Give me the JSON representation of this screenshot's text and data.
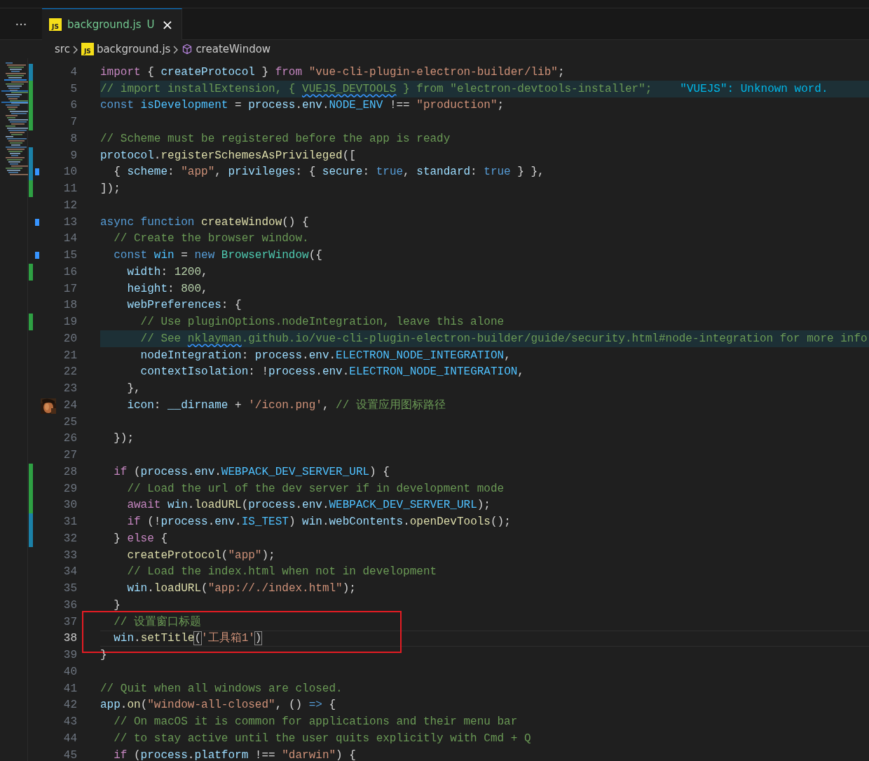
{
  "tab_bar": {
    "more": "···",
    "tabs": [
      {
        "icon_text": "JS",
        "label": "background.js",
        "status": "U",
        "close": "×",
        "selected": true
      }
    ]
  },
  "breadcrumb": [
    {
      "label": "src"
    },
    {
      "label": "background.js",
      "icon_text": "JS",
      "kind": "file"
    },
    {
      "label": "createWindow",
      "kind": "symbol"
    }
  ],
  "lines": [
    {
      "number": "4",
      "change_marker": {
        "color": "#1b81a8"
      },
      "tokens": [
        {
          "kind": "control",
          "text": "import"
        },
        {
          "kind": "plain",
          "text": " { "
        },
        {
          "kind": "variable",
          "text": "createProtocol"
        },
        {
          "kind": "plain",
          "text": " } "
        },
        {
          "kind": "control",
          "text": "from"
        },
        {
          "kind": "string",
          "text": " \"vue-cli-plugin-electron-builder/lib\""
        },
        {
          "kind": "plain",
          "text": ";"
        }
      ]
    },
    {
      "number": "5",
      "change_marker": {
        "color": "#2ea043"
      },
      "highlighted": true,
      "diagnostic": "\"VUEJS\": Unknown word.",
      "tokens": [
        {
          "kind": "comment",
          "text": "// import installExtension, { "
        },
        {
          "kind": "comment",
          "text": "VUEJS_DEVTOOLS",
          "squiggle": true
        },
        {
          "kind": "comment",
          "text": " } from \"electron-devtools-installer\";"
        }
      ]
    },
    {
      "number": "6",
      "change_marker": {
        "color": "#2ea043"
      },
      "tokens": [
        {
          "kind": "keyword",
          "text": "const"
        },
        {
          "kind": "constant",
          "text": " isDevelopment"
        },
        {
          "kind": "plain",
          "text": " = "
        },
        {
          "kind": "variable",
          "text": "process"
        },
        {
          "kind": "plain",
          "text": "."
        },
        {
          "kind": "variable",
          "text": "env"
        },
        {
          "kind": "plain",
          "text": "."
        },
        {
          "kind": "constant",
          "text": "NODE_ENV"
        },
        {
          "kind": "plain",
          "text": " !== "
        },
        {
          "kind": "string",
          "text": "\"production\""
        },
        {
          "kind": "plain",
          "text": ";"
        }
      ]
    },
    {
      "number": "7",
      "change_marker": {
        "color": "#2ea043"
      }
    },
    {
      "number": "8",
      "tokens": [
        {
          "kind": "comment",
          "text": "// Scheme must be registered before the app is ready"
        }
      ]
    },
    {
      "number": "9",
      "change_marker": {
        "color": "#1b81a8"
      },
      "tokens": [
        {
          "kind": "variable",
          "text": "protocol"
        },
        {
          "kind": "plain",
          "text": "."
        },
        {
          "kind": "function",
          "text": "registerSchemesAsPrivileged"
        },
        {
          "kind": "plain",
          "text": "(["
        }
      ]
    },
    {
      "number": "10",
      "change_marker": {
        "color": "#1b81a8"
      },
      "marker": true,
      "tokens": [
        {
          "kind": "plain",
          "text": "  { "
        },
        {
          "kind": "variable",
          "text": "scheme"
        },
        {
          "kind": "plain",
          "text": ": "
        },
        {
          "kind": "string",
          "text": "\"app\""
        },
        {
          "kind": "plain",
          "text": ", "
        },
        {
          "kind": "variable",
          "text": "privileges"
        },
        {
          "kind": "plain",
          "text": ": { "
        },
        {
          "kind": "variable",
          "text": "secure"
        },
        {
          "kind": "plain",
          "text": ": "
        },
        {
          "kind": "keyword",
          "text": "true"
        },
        {
          "kind": "plain",
          "text": ", "
        },
        {
          "kind": "variable",
          "text": "standard"
        },
        {
          "kind": "plain",
          "text": ": "
        },
        {
          "kind": "keyword",
          "text": "true"
        },
        {
          "kind": "plain",
          "text": " } },"
        }
      ]
    },
    {
      "number": "11",
      "change_marker": {
        "color": "#2ea043"
      },
      "tokens": [
        {
          "kind": "plain",
          "text": "]);"
        }
      ]
    },
    {
      "number": "12"
    },
    {
      "number": "13",
      "marker": true,
      "tokens": [
        {
          "kind": "keyword",
          "text": "async"
        },
        {
          "kind": "keyword",
          "text": " function"
        },
        {
          "kind": "function",
          "text": " createWindow"
        },
        {
          "kind": "plain",
          "text": "() {"
        }
      ]
    },
    {
      "number": "14",
      "tokens": [
        {
          "kind": "comment",
          "text": "  // Create the browser window."
        }
      ]
    },
    {
      "number": "15",
      "marker": true,
      "tokens": [
        {
          "kind": "keyword",
          "text": "  const"
        },
        {
          "kind": "constant",
          "text": " win"
        },
        {
          "kind": "plain",
          "text": " = "
        },
        {
          "kind": "keyword",
          "text": "new"
        },
        {
          "kind": "type",
          "text": " BrowserWindow"
        },
        {
          "kind": "plain",
          "text": "({"
        }
      ]
    },
    {
      "number": "16",
      "change_marker": {
        "color": "#2ea043"
      },
      "tokens": [
        {
          "kind": "variable",
          "text": "    width"
        },
        {
          "kind": "plain",
          "text": ": "
        },
        {
          "kind": "number",
          "text": "1200"
        },
        {
          "kind": "plain",
          "text": ","
        }
      ]
    },
    {
      "number": "17",
      "tokens": [
        {
          "kind": "variable",
          "text": "    height"
        },
        {
          "kind": "plain",
          "text": ": "
        },
        {
          "kind": "number",
          "text": "800"
        },
        {
          "kind": "plain",
          "text": ","
        }
      ]
    },
    {
      "number": "18",
      "tokens": [
        {
          "kind": "variable",
          "text": "    webPreferences"
        },
        {
          "kind": "plain",
          "text": ": {"
        }
      ]
    },
    {
      "number": "19",
      "change_marker": {
        "color": "#2ea043"
      },
      "tokens": [
        {
          "kind": "comment",
          "text": "      // Use pluginOptions.nodeIntegration, leave this alone"
        }
      ]
    },
    {
      "number": "20",
      "highlighted": true,
      "tokens": [
        {
          "kind": "comment",
          "text": "      // See "
        },
        {
          "kind": "comment",
          "text": "nklayman",
          "squiggle": true
        },
        {
          "kind": "comment",
          "text": ".github.io/vue-cli-plugin-electron-builder/guide/security.html#node-integration for more info"
        }
      ]
    },
    {
      "number": "21",
      "tokens": [
        {
          "kind": "variable",
          "text": "      nodeIntegration"
        },
        {
          "kind": "plain",
          "text": ": "
        },
        {
          "kind": "variable",
          "text": "process"
        },
        {
          "kind": "plain",
          "text": "."
        },
        {
          "kind": "variable",
          "text": "env"
        },
        {
          "kind": "plain",
          "text": "."
        },
        {
          "kind": "constant",
          "text": "ELECTRON_NODE_INTEGRATION"
        },
        {
          "kind": "plain",
          "text": ","
        }
      ]
    },
    {
      "number": "22",
      "tokens": [
        {
          "kind": "variable",
          "text": "      contextIsolation"
        },
        {
          "kind": "plain",
          "text": ": !"
        },
        {
          "kind": "variable",
          "text": "process"
        },
        {
          "kind": "plain",
          "text": "."
        },
        {
          "kind": "variable",
          "text": "env"
        },
        {
          "kind": "plain",
          "text": "."
        },
        {
          "kind": "constant",
          "text": "ELECTRON_NODE_INTEGRATION"
        },
        {
          "kind": "plain",
          "text": ","
        }
      ]
    },
    {
      "number": "23",
      "tokens": [
        {
          "kind": "plain",
          "text": "    },"
        }
      ]
    },
    {
      "number": "24",
      "avatar": {
        "kind": "picture"
      },
      "tokens": [
        {
          "kind": "variable",
          "text": "    icon"
        },
        {
          "kind": "plain",
          "text": ": "
        },
        {
          "kind": "variable",
          "text": "__dirname"
        },
        {
          "kind": "plain",
          "text": " + "
        },
        {
          "kind": "string",
          "text": "'/icon.png'"
        },
        {
          "kind": "plain",
          "text": ", "
        },
        {
          "kind": "comment",
          "text": "// 设置应用图标路径"
        }
      ]
    },
    {
      "number": "25"
    },
    {
      "number": "26",
      "tokens": [
        {
          "kind": "plain",
          "text": "  });"
        }
      ]
    },
    {
      "number": "27"
    },
    {
      "number": "28",
      "change_marker": {
        "color": "#2ea043"
      },
      "tokens": [
        {
          "kind": "control",
          "text": "  if"
        },
        {
          "kind": "plain",
          "text": " ("
        },
        {
          "kind": "variable",
          "text": "process"
        },
        {
          "kind": "plain",
          "text": "."
        },
        {
          "kind": "variable",
          "text": "env"
        },
        {
          "kind": "plain",
          "text": "."
        },
        {
          "kind": "constant",
          "text": "WEBPACK_DEV_SERVER_URL"
        },
        {
          "kind": "plain",
          "text": ") {"
        }
      ]
    },
    {
      "number": "29",
      "change_marker": {
        "color": "#2ea043"
      },
      "tokens": [
        {
          "kind": "comment",
          "text": "    // Load the url of the dev server if in development mode"
        }
      ]
    },
    {
      "number": "30",
      "change_marker": {
        "color": "#2ea043"
      },
      "tokens": [
        {
          "kind": "control",
          "text": "    await"
        },
        {
          "kind": "variable",
          "text": " win"
        },
        {
          "kind": "plain",
          "text": "."
        },
        {
          "kind": "function",
          "text": "loadURL"
        },
        {
          "kind": "plain",
          "text": "("
        },
        {
          "kind": "variable",
          "text": "process"
        },
        {
          "kind": "plain",
          "text": "."
        },
        {
          "kind": "variable",
          "text": "env"
        },
        {
          "kind": "plain",
          "text": "."
        },
        {
          "kind": "constant",
          "text": "WEBPACK_DEV_SERVER_URL"
        },
        {
          "kind": "plain",
          "text": ");"
        }
      ]
    },
    {
      "number": "31",
      "change_marker": {
        "color": "#1b81a8"
      },
      "tokens": [
        {
          "kind": "control",
          "text": "    if"
        },
        {
          "kind": "plain",
          "text": " (!"
        },
        {
          "kind": "variable",
          "text": "process"
        },
        {
          "kind": "plain",
          "text": "."
        },
        {
          "kind": "variable",
          "text": "env"
        },
        {
          "kind": "plain",
          "text": "."
        },
        {
          "kind": "constant",
          "text": "IS_TEST"
        },
        {
          "kind": "plain",
          "text": ") "
        },
        {
          "kind": "variable",
          "text": "win"
        },
        {
          "kind": "plain",
          "text": "."
        },
        {
          "kind": "variable",
          "text": "webContents"
        },
        {
          "kind": "plain",
          "text": "."
        },
        {
          "kind": "function",
          "text": "openDevTools"
        },
        {
          "kind": "plain",
          "text": "();"
        }
      ]
    },
    {
      "number": "32",
      "change_marker": {
        "color": "#1b81a8"
      },
      "tokens": [
        {
          "kind": "plain",
          "text": "  } "
        },
        {
          "kind": "control",
          "text": "else"
        },
        {
          "kind": "plain",
          "text": " {"
        }
      ]
    },
    {
      "number": "33",
      "tokens": [
        {
          "kind": "function",
          "text": "    createProtocol"
        },
        {
          "kind": "plain",
          "text": "("
        },
        {
          "kind": "string",
          "text": "\"app\""
        },
        {
          "kind": "plain",
          "text": ");"
        }
      ]
    },
    {
      "number": "34",
      "tokens": [
        {
          "kind": "comment",
          "text": "    // Load the index.html when not in development"
        }
      ]
    },
    {
      "number": "35",
      "tokens": [
        {
          "kind": "variable",
          "text": "    win"
        },
        {
          "kind": "plain",
          "text": "."
        },
        {
          "kind": "function",
          "text": "loadURL"
        },
        {
          "kind": "plain",
          "text": "("
        },
        {
          "kind": "string",
          "text": "\"app://./index.html\""
        },
        {
          "kind": "plain",
          "text": ");"
        }
      ]
    },
    {
      "number": "36",
      "tokens": [
        {
          "kind": "plain",
          "text": "  }"
        }
      ]
    },
    {
      "number": "37",
      "boxed": true,
      "tokens": [
        {
          "kind": "comment",
          "text": "  // 设置窗口标题"
        }
      ]
    },
    {
      "number": "38",
      "boxed": true,
      "current": true,
      "tokens": [
        {
          "kind": "variable",
          "text": "  win"
        },
        {
          "kind": "plain",
          "text": "."
        },
        {
          "kind": "function",
          "text": "setTitle"
        },
        {
          "kind": "plain",
          "text": "(",
          "matched": true
        },
        {
          "kind": "string",
          "text": "'工具箱1'"
        },
        {
          "kind": "plain",
          "text": ")",
          "matched": true
        }
      ]
    },
    {
      "number": "39",
      "tokens": [
        {
          "kind": "plain",
          "text": "}"
        }
      ]
    },
    {
      "number": "40"
    },
    {
      "number": "41",
      "tokens": [
        {
          "kind": "comment",
          "text": "// Quit when all windows are closed."
        }
      ]
    },
    {
      "number": "42",
      "tokens": [
        {
          "kind": "variable",
          "text": "app"
        },
        {
          "kind": "plain",
          "text": "."
        },
        {
          "kind": "function",
          "text": "on"
        },
        {
          "kind": "plain",
          "text": "("
        },
        {
          "kind": "string",
          "text": "\"window-all-closed\""
        },
        {
          "kind": "plain",
          "text": ", () "
        },
        {
          "kind": "keyword",
          "text": "=>"
        },
        {
          "kind": "plain",
          "text": " {"
        }
      ]
    },
    {
      "number": "43",
      "tokens": [
        {
          "kind": "comment",
          "text": "  // On macOS it is common for applications and their menu bar"
        }
      ]
    },
    {
      "number": "44",
      "tokens": [
        {
          "kind": "comment",
          "text": "  // to stay active until the user quits explicitly with Cmd + Q"
        }
      ]
    },
    {
      "number": "45",
      "tokens": [
        {
          "kind": "control",
          "text": "  if"
        },
        {
          "kind": "plain",
          "text": " ("
        },
        {
          "kind": "variable",
          "text": "process"
        },
        {
          "kind": "plain",
          "text": "."
        },
        {
          "kind": "variable",
          "text": "platform"
        },
        {
          "kind": "plain",
          "text": " !== "
        },
        {
          "kind": "string",
          "text": "\"darwin\""
        },
        {
          "kind": "plain",
          "text": ") {"
        }
      ]
    }
  ]
}
